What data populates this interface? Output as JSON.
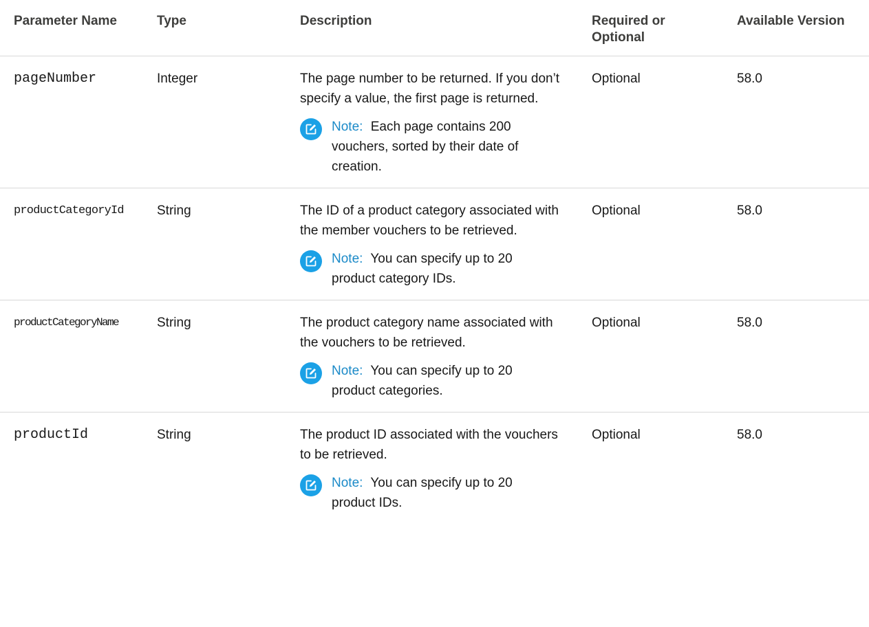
{
  "columns": {
    "name": "Parameter Name",
    "type": "Type",
    "description": "Description",
    "required": "Required or Optional",
    "version": "Available Version"
  },
  "rows": [
    {
      "name": "pageNumber",
      "type": "Integer",
      "description": "The page number to be returned. If you don’t specify a value, the first page is returned.",
      "note_label": "Note:",
      "note_text": "Each page contains 200 vouchers, sorted by their date of creation.",
      "required": "Optional",
      "version": "58.0"
    },
    {
      "name": "productCategoryId",
      "type": "String",
      "description": "The ID of a product category associated with the member vouchers to be retrieved.",
      "note_label": "Note:",
      "note_text": "You can specify up to 20 product category IDs.",
      "required": "Optional",
      "version": "58.0"
    },
    {
      "name": "productCategoryName",
      "type": "String",
      "description": "The product category name associated with the vouchers to be retrieved.",
      "note_label": "Note:",
      "note_text": "You can specify up to 20 product categories.",
      "required": "Optional",
      "version": "58.0"
    },
    {
      "name": "productId",
      "type": "String",
      "description": "The product ID associated with the vouchers to be retrieved.",
      "note_label": "Note:",
      "note_text": "You can specify up to 20 product IDs.",
      "required": "Optional",
      "version": "58.0"
    }
  ],
  "icons": {
    "note": "edit-note-icon"
  },
  "colors": {
    "note_icon_bg": "#1ba1e6",
    "note_label": "#1b8ac8",
    "row_divider": "#d8d8d8"
  }
}
